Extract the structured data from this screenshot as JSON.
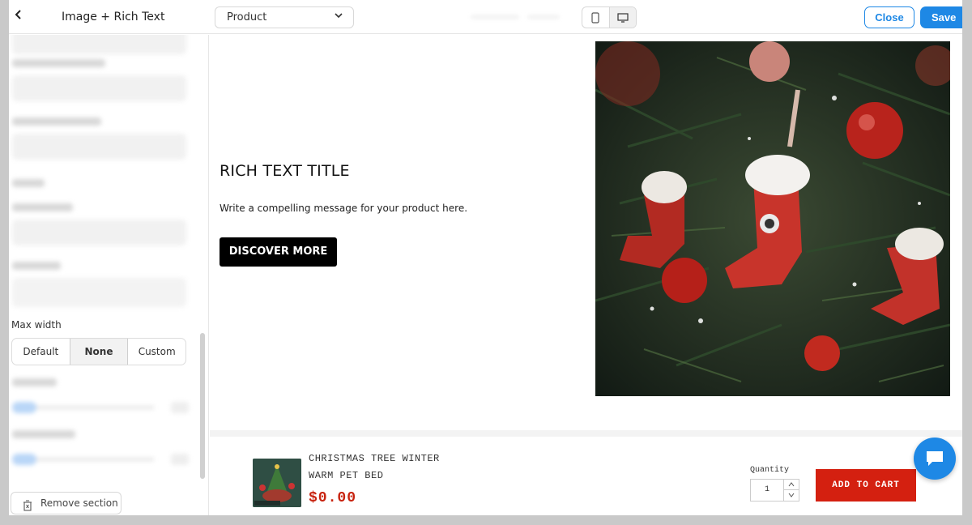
{
  "header": {
    "panel_title": "Image + Rich Text",
    "template_select": "Product",
    "close_label": "Close",
    "save_label": "Save"
  },
  "sidebar": {
    "max_width_label": "Max width",
    "max_width_options": [
      "Default",
      "None",
      "Custom"
    ],
    "max_width_selected": "None",
    "remove_section_label": "Remove section"
  },
  "section": {
    "title": "RICH TEXT TITLE",
    "text": "Write a compelling message for your product here.",
    "button_label": "DISCOVER MORE"
  },
  "sticky_cart": {
    "product_title_line1": "CHRISTMAS TREE WINTER",
    "product_title_line2": "WARM PET BED",
    "price": "$0.00",
    "quantity_label": "Quantity",
    "quantity_value": "1",
    "add_to_cart_label": "ADD TO CART"
  },
  "colors": {
    "accent": "#1e88e5",
    "cta_black": "#000000",
    "cart_red": "#d42010",
    "price_red": "#c8230f"
  },
  "icons": [
    "back-icon",
    "chevron-down-icon",
    "mobile-icon",
    "desktop-icon",
    "trash-icon",
    "chat-icon"
  ]
}
